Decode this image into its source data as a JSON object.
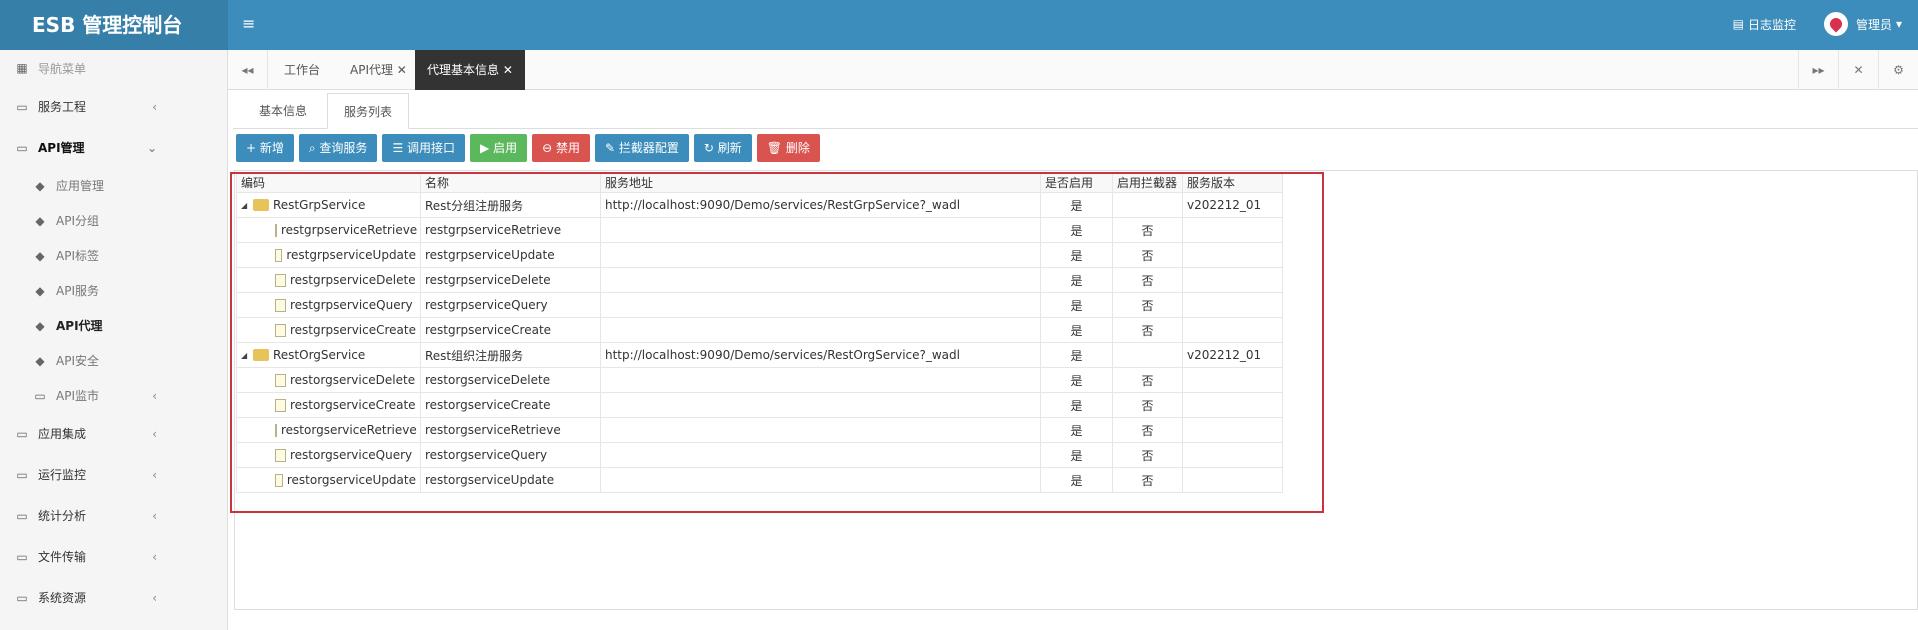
{
  "topbar": {
    "logo": "ESB 管理控制台",
    "menu_icon": "≡",
    "log_monitor": "日志监控",
    "user": "管理员"
  },
  "sidebar": {
    "header": "导航菜单",
    "items": [
      {
        "label": "服务工程"
      },
      {
        "label": "API管理"
      },
      {
        "label": "应用管理"
      },
      {
        "label": "API分组"
      },
      {
        "label": "API标签"
      },
      {
        "label": "API服务"
      },
      {
        "label": "API代理"
      },
      {
        "label": "API安全"
      },
      {
        "label": "API监市"
      },
      {
        "label": "应用集成"
      },
      {
        "label": "运行监控"
      },
      {
        "label": "统计分析"
      },
      {
        "label": "文件传输"
      },
      {
        "label": "系统资源"
      }
    ]
  },
  "tabs": [
    {
      "label": "工作台"
    },
    {
      "label": "API代理 ✕"
    },
    {
      "label": "代理基本信息 ✕"
    }
  ],
  "subtabs": [
    "基本信息",
    "服务列表"
  ],
  "toolbar": {
    "add": "+ 新增",
    "query": "查询服务",
    "call": "调用接口",
    "enable": "启用",
    "disable": "禁用",
    "interceptor": "拦截器配置",
    "refresh": "刷新",
    "delete": "删除"
  },
  "grid": {
    "headers": [
      "编码",
      "名称",
      "服务地址",
      "是否启用",
      "启用拦截器",
      "服务版本"
    ],
    "rows": [
      {
        "code": "RestGrpService",
        "name": "Rest分组注册服务",
        "url": "http://localhost:9090/Demo/services/RestGrpService?_wadl",
        "enabled": "是",
        "interceptor": "",
        "version": "v202212_01"
      },
      {
        "code": "restgrpserviceRetrieve",
        "name": "restgrpserviceRetrieve",
        "url": "",
        "enabled": "是",
        "interceptor": "否",
        "version": ""
      },
      {
        "code": "restgrpserviceUpdate",
        "name": "restgrpserviceUpdate",
        "url": "",
        "enabled": "是",
        "interceptor": "否",
        "version": ""
      },
      {
        "code": "restgrpserviceDelete",
        "name": "restgrpserviceDelete",
        "url": "",
        "enabled": "是",
        "interceptor": "否",
        "version": ""
      },
      {
        "code": "restgrpserviceQuery",
        "name": "restgrpserviceQuery",
        "url": "",
        "enabled": "是",
        "interceptor": "否",
        "version": ""
      },
      {
        "code": "restgrpserviceCreate",
        "name": "restgrpserviceCreate",
        "url": "",
        "enabled": "是",
        "interceptor": "否",
        "version": ""
      },
      {
        "code": "RestOrgService",
        "name": "Rest组织注册服务",
        "url": "http://localhost:9090/Demo/services/RestOrgService?_wadl",
        "enabled": "是",
        "interceptor": "",
        "version": "v202212_01"
      },
      {
        "code": "restorgserviceDelete",
        "name": "restorgserviceDelete",
        "url": "",
        "enabled": "是",
        "interceptor": "否",
        "version": ""
      },
      {
        "code": "restorgserviceCreate",
        "name": "restorgserviceCreate",
        "url": "",
        "enabled": "是",
        "interceptor": "否",
        "version": ""
      },
      {
        "code": "restorgserviceRetrieve",
        "name": "restorgserviceRetrieve",
        "url": "",
        "enabled": "是",
        "interceptor": "否",
        "version": ""
      },
      {
        "code": "restorgserviceQuery",
        "name": "restorgserviceQuery",
        "url": "",
        "enabled": "是",
        "interceptor": "否",
        "version": ""
      },
      {
        "code": "restorgserviceUpdate",
        "name": "restorgserviceUpdate",
        "url": "",
        "enabled": "是",
        "interceptor": "否",
        "version": ""
      }
    ]
  }
}
